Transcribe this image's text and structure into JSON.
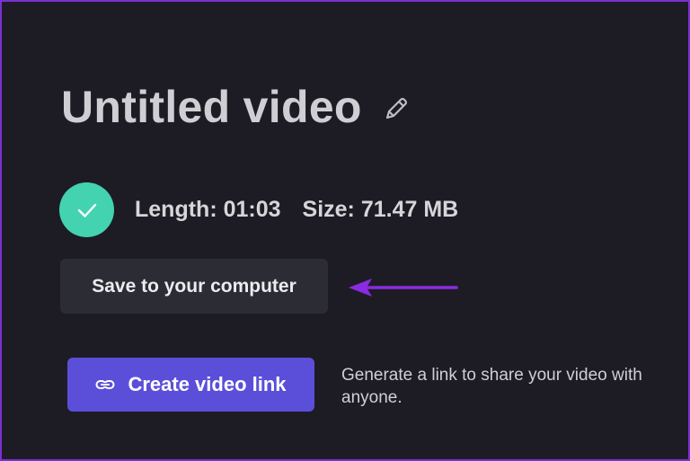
{
  "header": {
    "title": "Untitled video",
    "edit_icon": "pencil-icon"
  },
  "status": {
    "icon": "checkmark-icon",
    "length_text": "Length: 01:03",
    "size_text": "Size: 71.47 MB",
    "accent_color": "#44d3b0"
  },
  "actions": {
    "save_label": "Save to your computer",
    "create_link_label": "Create video link",
    "create_link_icon": "link-icon",
    "create_link_description": "Generate a link to share your video with anyone."
  },
  "annotation": {
    "arrow_color": "#8a2be2"
  },
  "colors": {
    "background": "#1d1c24",
    "primary_button": "#5b4fd9",
    "secondary_button": "#2c2c35"
  }
}
